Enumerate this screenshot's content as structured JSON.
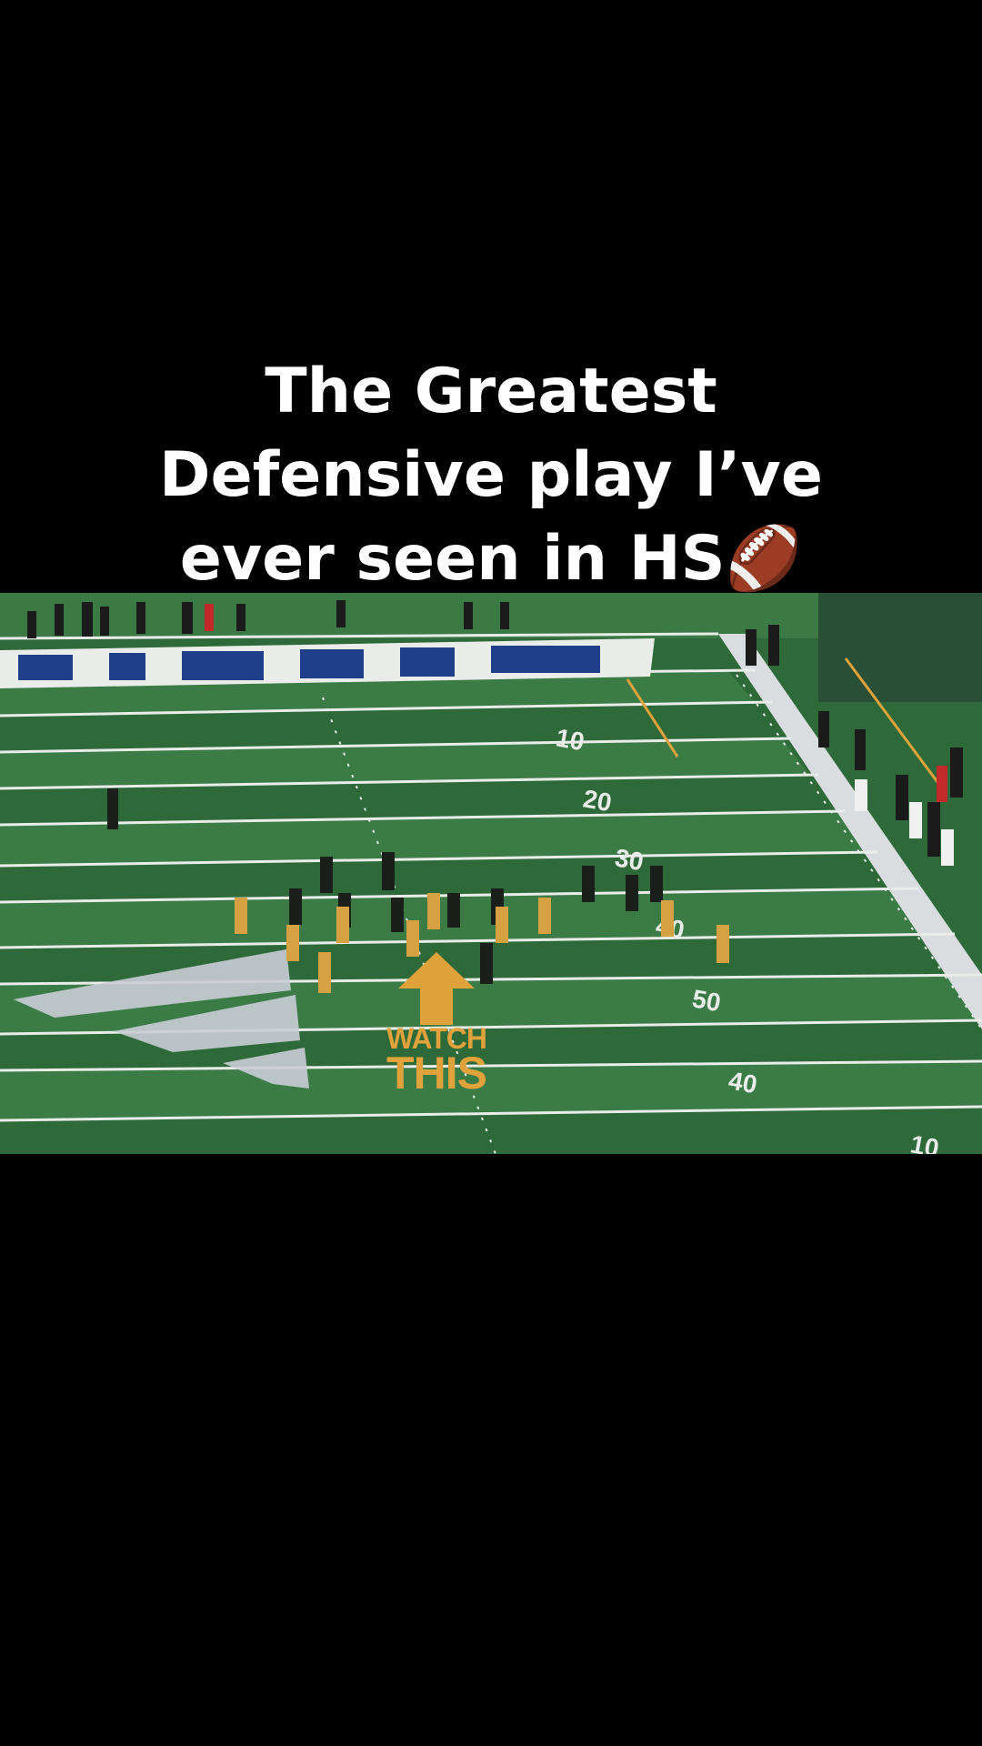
{
  "caption": {
    "line1": "The Greatest",
    "line2": "Defensive play I’ve",
    "line3": "ever seen in HS🏈"
  },
  "video": {
    "overlay_watch": "WATCH",
    "overlay_this": "THIS",
    "yard_numbers": [
      "10",
      "20",
      "30",
      "40",
      "50",
      "40",
      "10"
    ],
    "colors": {
      "field": "#2f6b3a",
      "stripe": "#3a7a45",
      "line": "#e8e8e8",
      "accent": "#e0a23a",
      "endzone_text": "#1f3f8a"
    }
  }
}
